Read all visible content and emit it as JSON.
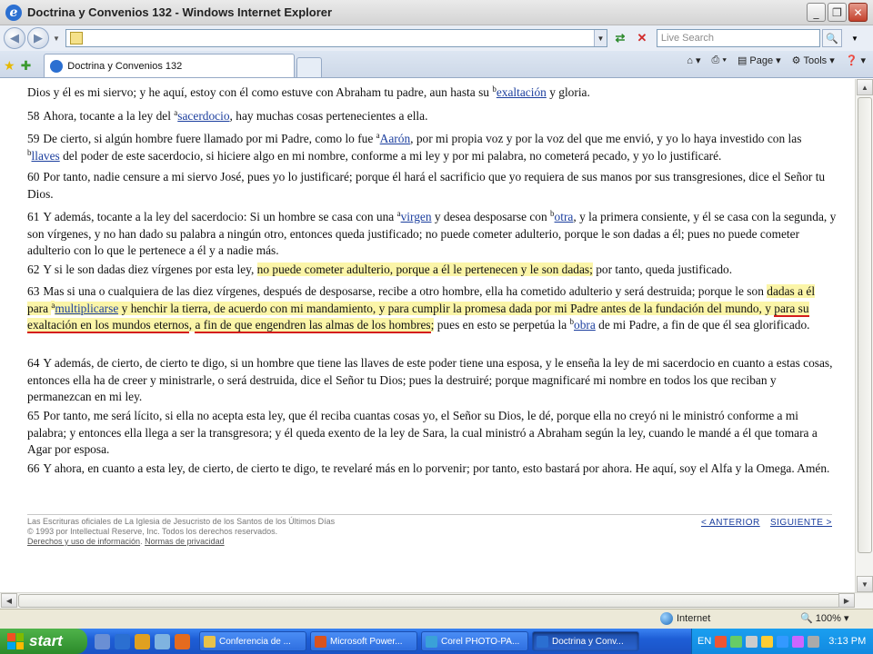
{
  "window": {
    "title": "Doctrina y Convenios 132 - Windows Internet Explorer",
    "minimize": "_",
    "maximize": "❐",
    "close": "✕"
  },
  "address_bar": {
    "url": "",
    "search_placeholder": "Live Search"
  },
  "tabs": [
    {
      "label": "Doctrina y Convenios 132"
    }
  ],
  "commands": {
    "page": "Page",
    "tools": "Tools"
  },
  "content": {
    "p0": {
      "a": "Dios y él es mi siervo; y he aquí, estoy con él como estuve con Abraham tu padre, aun hasta su ",
      "sup": "b",
      "link": "exaltación",
      "b": " y gloria."
    },
    "p58": {
      "num": "58",
      "a": "Ahora, tocante a la ley del ",
      "sup": "a",
      "link": "sacerdocio",
      "b": ", hay muchas cosas pertenecientes a ella."
    },
    "p59": {
      "num": "59",
      "a": "De cierto, si algún hombre fuere llamado por mi Padre, como lo fue ",
      "sup1": "a",
      "link1": "Aarón",
      "b": ", por mi propia voz y por la voz del que me envió, y yo lo haya investido con las ",
      "sup2": "b",
      "link2": "llaves",
      "c": " del poder de este sacerdocio, si hiciere algo en mi nombre, conforme a mi ley y por mi palabra, no cometerá pecado, y yo lo justificaré."
    },
    "p60": {
      "num": "60",
      "a": "Por tanto, nadie censure a mi siervo José, pues yo lo justificaré; porque él hará el sacrificio que yo requiera de sus manos por sus transgresiones, dice el Señor tu Dios."
    },
    "p61": {
      "num": "61",
      "a": "Y además, tocante a la ley del sacerdocio: Si un hombre se casa con una ",
      "sup1": "a",
      "link1": "virgen",
      "b": " y desea desposarse con ",
      "sup2": "b",
      "link2": "otra",
      "c": ", y la primera consiente, y él se casa con la segunda, y son vírgenes, y no han dado su palabra a ningún otro, entonces queda justificado; no puede cometer adulterio, porque le son dadas a él; pues no puede cometer adulterio con lo que le pertenece a él y a nadie más."
    },
    "p62": {
      "num": "62",
      "a": "Y si le son dadas diez vírgenes por esta ley, ",
      "hl": "no puede cometer adulterio, porque a él le pertenecen y le son dadas;",
      "b": " por tanto, queda justificado."
    },
    "p63": {
      "num": "63",
      "a": "Mas si una o cualquiera de las diez vírgenes, después de desposarse, recibe a otro hombre, ella ha cometido adulterio y será destruida; porque le son ",
      "hl1": "dadas a él para ",
      "sup1": "a",
      "link1": "multiplicarse",
      "hl2": " y henchir la tierra, de acuerdo con mi mandamiento, y para cumplir la promesa dada por mi Padre antes de la fundación del mundo, y ",
      "ul1": "para su exaltación en los mundos eternos",
      "hl3": ", ",
      "ul2": "a fin de que engendren las almas de los hombres",
      "hl4": ";",
      "b": " pues en esto se perpetúa la ",
      "sup2": "b",
      "link2": "obra",
      "c": " de mi Padre, a fin de que él sea glorificado."
    },
    "p64": {
      "num": "64",
      "a": "Y además, de cierto, de cierto te digo, si un hombre que tiene las llaves de este poder tiene una esposa, y le enseña la ley de mi sacerdocio en cuanto a estas cosas, entonces ella ha de creer y ministrarle, o será destruida, dice el Señor tu Dios; pues la destruiré; porque magnificaré mi nombre en todos los que reciban y permanezcan en mi ley."
    },
    "p65": {
      "num": "65",
      "a": "Por tanto, me será lícito, si ella no acepta esta ley, que él reciba cuantas cosas yo, el Señor su Dios, le dé, porque ella no creyó ni le ministró conforme a mi palabra; y entonces ella llega a ser la transgresora; y él queda exento de la ley de Sara, la cual ministró a Abraham según la ley, cuando le mandé a él que tomara a Agar por esposa."
    },
    "p66": {
      "num": "66",
      "a": "Y ahora, en cuanto a esta ley, de cierto, de cierto te digo, te revelaré más en lo porvenir; por tanto, esto bastará por ahora. He aquí, soy el Alfa y la Omega. Amén."
    }
  },
  "footer": {
    "line1": "Las Escrituras oficiales de La Iglesia de Jesucristo de los Santos de los Últimos Días",
    "line2": "© 1993 por Intellectual Reserve, Inc. Todos los derechos reservados.",
    "link_terms": "Derechos y uso de información",
    "link_privacy": "Normas de privacidad",
    "prev": "< ANTERIOR",
    "next": "SIGUIENTE >"
  },
  "status": {
    "zone": "Internet",
    "zoom": "100%"
  },
  "taskbar": {
    "start": "start",
    "tasks": [
      {
        "label": "Conferencia de ...",
        "color": "#e8c24a"
      },
      {
        "label": "Microsoft Power...",
        "color": "#d9531e"
      },
      {
        "label": "Corel PHOTO-PA...",
        "color": "#3aa1d8"
      },
      {
        "label": "Doctrina y Conv...",
        "color": "#2b6fd1"
      }
    ],
    "lang": "EN",
    "clock": "3:13 PM"
  }
}
